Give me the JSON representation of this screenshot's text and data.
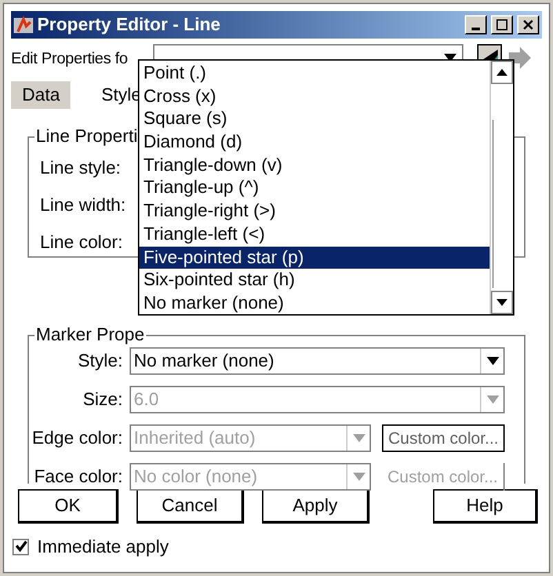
{
  "window": {
    "title": "Property Editor - Line"
  },
  "edit_properties": {
    "label": "Edit Properties fo"
  },
  "tabs": [
    {
      "label": "Data",
      "selected": true
    },
    {
      "label": "Style",
      "selected": false
    }
  ],
  "line_properties": {
    "title": "Line Properti",
    "rows": [
      {
        "label": "Line style:"
      },
      {
        "label": "Line width:"
      },
      {
        "label": "Line color:"
      }
    ]
  },
  "marker_list": {
    "items": [
      {
        "label": "Point (.)",
        "selected": false
      },
      {
        "label": "Cross (x)",
        "selected": false
      },
      {
        "label": "Square (s)",
        "selected": false
      },
      {
        "label": "Diamond (d)",
        "selected": false
      },
      {
        "label": "Triangle-down (v)",
        "selected": false
      },
      {
        "label": "Triangle-up (^)",
        "selected": false
      },
      {
        "label": "Triangle-right (>)",
        "selected": false
      },
      {
        "label": "Triangle-left  (<)",
        "selected": false
      },
      {
        "label": "Five-pointed star (p)",
        "selected": true
      },
      {
        "label": "Six-pointed star (h)",
        "selected": false
      },
      {
        "label": "No marker (none)",
        "selected": false
      }
    ]
  },
  "marker_properties": {
    "title": "Marker Prope",
    "rows": [
      {
        "label": "Style:",
        "value": "No marker (none)",
        "disabled": false
      },
      {
        "label": "Size:",
        "value": "6.0",
        "disabled": true
      },
      {
        "label": "Edge color:",
        "value": "Inherited (auto)",
        "disabled": true,
        "button": "Custom color...",
        "button_disabled": false
      },
      {
        "label": "Face color:",
        "value": "No color (none)",
        "disabled": true,
        "button": "Custom color...",
        "button_disabled": true
      }
    ]
  },
  "buttons": [
    "OK",
    "Cancel",
    "Apply",
    "Help"
  ],
  "immediate_apply": {
    "label": "Immediate apply",
    "checked": true
  }
}
